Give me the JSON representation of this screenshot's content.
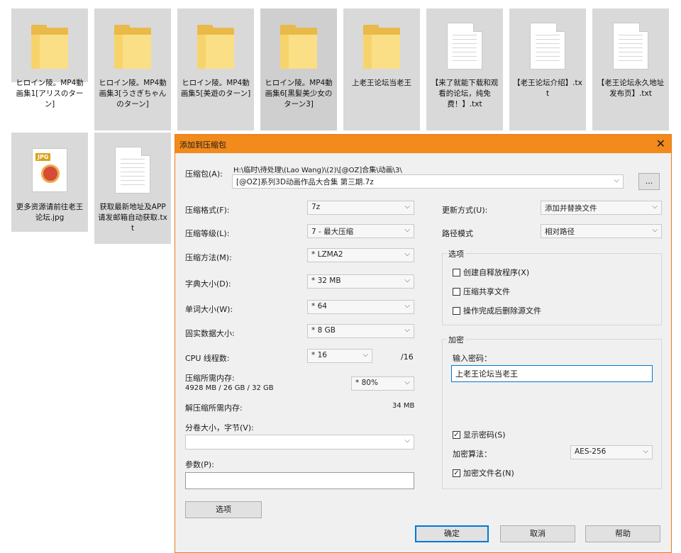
{
  "files": [
    {
      "name": "ヒロイン陵。MP4動画集1[アリスのターン]",
      "type": "folder"
    },
    {
      "name": "ヒロイン陵。MP4動画集3[うさぎちゃんのターン]",
      "type": "folder"
    },
    {
      "name": "ヒロイン陵。MP4動画集5[美遊のターン]",
      "type": "folder"
    },
    {
      "name": "ヒロイン陵。MP4動画集6[黒髪美少女のターン3]",
      "type": "folder"
    },
    {
      "name": "上老王论坛当老王",
      "type": "folder"
    },
    {
      "name": "【来了就能下载和观看的论坛，纯免费！】.txt",
      "type": "txt"
    },
    {
      "name": "【老王论坛介绍】.txt",
      "type": "txt"
    },
    {
      "name": "【老王论坛永久地址发布页】.txt",
      "type": "txt"
    },
    {
      "name": "更多资源请前往老王论坛.jpg",
      "type": "jpg",
      "badge": "JPG"
    },
    {
      "name": "获取最新地址及APP请发邮箱自动获取.txt",
      "type": "txt"
    }
  ],
  "dialog": {
    "title": "添加到压缩包",
    "close": "✕",
    "archive_label": "压缩包(A):",
    "archive_path": "H:\\临时\\待处理\\(Lao Wang)\\(2)\\[@OZ]合集\\动画\\3\\",
    "archive_name": "[@OZ]系列3D动画作品大合集 第三期.7z",
    "browse_button": "...",
    "left_fields": [
      {
        "label": "压缩格式(F):",
        "value": "7z"
      },
      {
        "label": "压缩等级(L):",
        "value": "7 - 最大压缩"
      },
      {
        "label": "压缩方法(M):",
        "value": "* LZMA2"
      },
      {
        "label": "字典大小(D):",
        "value": "* 32 MB"
      },
      {
        "label": "单词大小(W):",
        "value": "* 64"
      },
      {
        "label": "固实数据大小:",
        "value": "* 8 GB"
      }
    ],
    "cpu_label": "CPU 线程数:",
    "cpu_value": "* 16",
    "cpu_total": "/16",
    "mem_compress_label": "压缩所需内存:",
    "mem_compress_value": "4928 MB / 26 GB / 32 GB",
    "mem_percent": "* 80%",
    "mem_decompress_label": "解压缩所需内存:",
    "mem_decompress_value": "34 MB",
    "split_label": "分卷大小，字节(V):",
    "split_value": "",
    "params_label": "参数(P):",
    "params_value": "",
    "options_button": "选项",
    "update_label": "更新方式(U):",
    "update_value": "添加并替换文件",
    "path_label": "路径模式",
    "path_value": "相对路径",
    "options_group": "选项",
    "options": [
      {
        "label": "创建自释放程序(X)",
        "checked": false
      },
      {
        "label": "压缩共享文件",
        "checked": false
      },
      {
        "label": "操作完成后删除源文件",
        "checked": false
      }
    ],
    "encrypt_group": "加密",
    "password_label": "输入密码：",
    "password_value": "上老王论坛当老王",
    "show_password_label": "显示密码(S)",
    "show_password_checked": true,
    "algo_label": "加密算法：",
    "algo_value": "AES-256",
    "encrypt_names_label": "加密文件名(N)",
    "encrypt_names_checked": true,
    "ok_button": "确定",
    "cancel_button": "取消",
    "help_button": "帮助"
  },
  "colors": {
    "titlebar": "#f28a1c",
    "folder": "#f7d46b",
    "tile_bg": "#d9d9d9"
  }
}
